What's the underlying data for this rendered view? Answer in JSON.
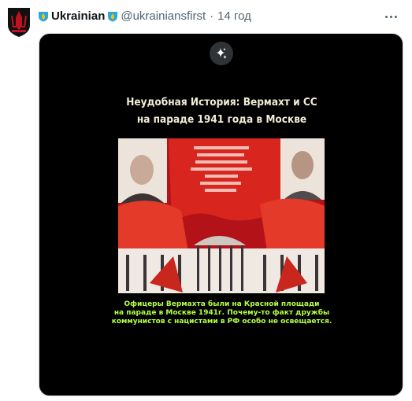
{
  "author": {
    "display_name": "Ukrainian",
    "handle": "@ukrainiansfirst",
    "separator": "·",
    "time": "14 год",
    "avatar_icon": "trident-shield-icon",
    "badge_icon": "ukraine-shield-emoji-icon"
  },
  "actions": {
    "more_icon": "more-dots-icon",
    "sparkle_icon": "sparkle-icon"
  },
  "media": {
    "title_line1": "Неудобная История: Вермахт и СС",
    "title_line2": "на параде 1941 года в Москве",
    "caption_line1": "Офицеры Вермахта были на Красной площади",
    "caption_line2": "на параде в Москве 1941г. Почему-то факт дружбы",
    "caption_line3": "коммунистов с нацистами в РФ особо не освещается."
  },
  "colors": {
    "title": "#f2ecd7",
    "caption": "#b6ff45",
    "banner_red": "#d8261e",
    "muted": "#536471"
  }
}
